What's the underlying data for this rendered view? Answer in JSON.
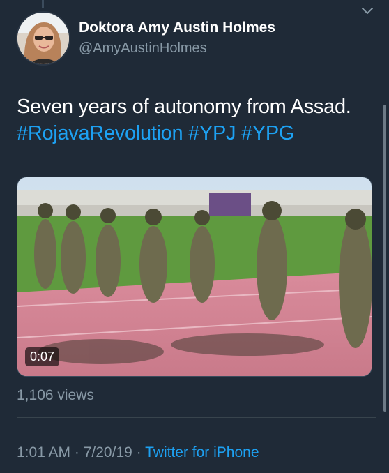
{
  "author": {
    "name": "Doktora Amy Austin Holmes",
    "handle": "@AmyAustinHolmes"
  },
  "tweet": {
    "text": "Seven years of autonomy from Assad.",
    "hashtags": [
      "#RojavaRevolution",
      "#YPJ",
      "#YPG"
    ]
  },
  "media": {
    "type": "video",
    "duration": "0:07"
  },
  "stats": {
    "views": "1,106 views"
  },
  "meta": {
    "time": "1:01 AM",
    "separator1": " · ",
    "date": "7/20/19",
    "separator2": " · ",
    "source": "Twitter for iPhone"
  },
  "icons": {
    "menu": "chevron-down-icon"
  },
  "colors": {
    "background": "#1f2a37",
    "text": "#ffffff",
    "secondary": "#8899a6",
    "link": "#1da1f2"
  }
}
